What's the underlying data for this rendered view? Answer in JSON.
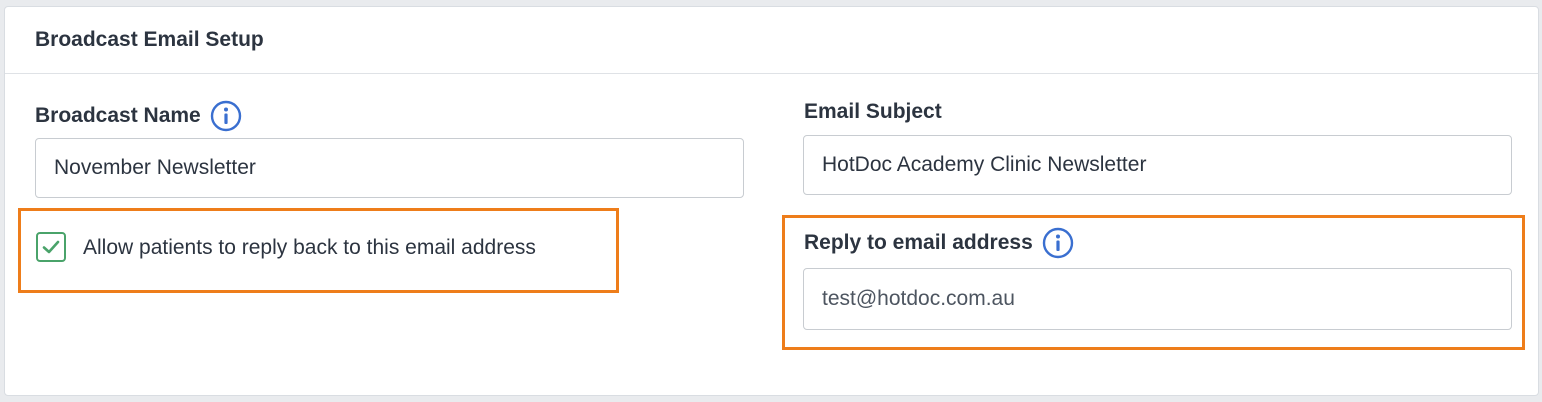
{
  "card": {
    "title": "Broadcast Email Setup"
  },
  "broadcast_name": {
    "label": "Broadcast Name",
    "value": "November Newsletter"
  },
  "email_subject": {
    "label": "Email Subject",
    "value": "HotDoc Academy Clinic Newsletter"
  },
  "allow_reply": {
    "label": "Allow patients to reply back to this email address",
    "checked": true
  },
  "reply_to": {
    "label": "Reply to email address",
    "value": "test@hotdoc.com.au"
  },
  "icons": {
    "info": "info-icon",
    "check": "check-icon"
  },
  "colors": {
    "highlight": "#ee7d1a",
    "info_icon": "#3a6fd0",
    "checkbox": "#4aa36a"
  }
}
